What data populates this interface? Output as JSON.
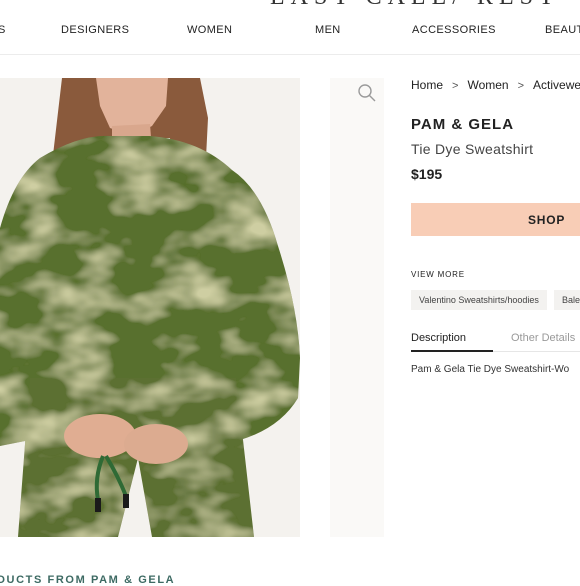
{
  "site": {
    "logo_text": "LAST CALL/ REST"
  },
  "nav": {
    "items": [
      {
        "label": "S"
      },
      {
        "label": "DESIGNERS"
      },
      {
        "label": "WOMEN"
      },
      {
        "label": "MEN"
      },
      {
        "label": "ACCESSORIES"
      },
      {
        "label": "BEAUTY"
      }
    ]
  },
  "breadcrumb": {
    "items": [
      "Home",
      "Women",
      "Activewear"
    ],
    "separator": ">"
  },
  "product": {
    "brand": "PAM & GELA",
    "name": "Tie Dye Sweatshirt",
    "price": "$195",
    "shop_label": "SHOP",
    "view_more_label": "VIEW MORE",
    "tags": [
      "Valentino Sweatshirts/hoodies",
      "Bale"
    ],
    "tabs": [
      {
        "label": "Description",
        "active": true
      },
      {
        "label": "Other Details",
        "active": false
      }
    ],
    "description": "Pam & Gela Tie Dye Sweatshirt-Wo",
    "image_alt": "tie-dye-green-sweatshirt-photo"
  },
  "related_heading": "DUCTS FROM PAM & GELA",
  "colors": {
    "shop_button": "#f8cdb6",
    "garment_green": "#556b2f",
    "related_heading": "#3d6a63"
  }
}
